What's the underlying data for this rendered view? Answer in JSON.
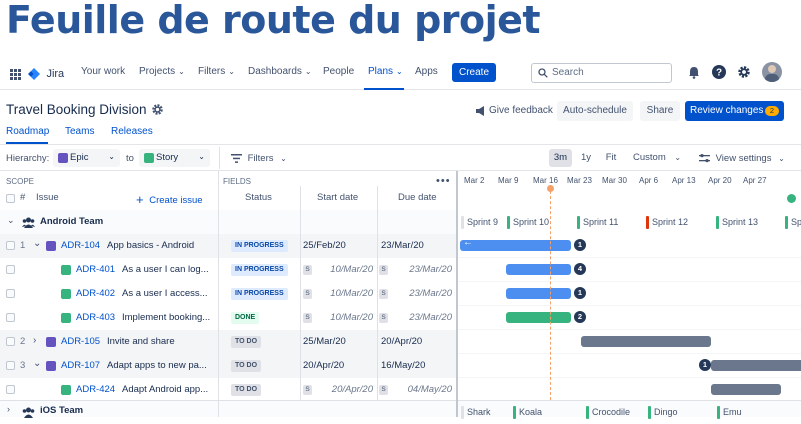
{
  "hero": {
    "title": "Feuille de route du projet"
  },
  "nav": {
    "logo": "Jira",
    "items": [
      {
        "label": "Your work",
        "dropdown": false
      },
      {
        "label": "Projects",
        "dropdown": true
      },
      {
        "label": "Filters",
        "dropdown": true
      },
      {
        "label": "Dashboards",
        "dropdown": true
      },
      {
        "label": "People",
        "dropdown": false
      },
      {
        "label": "Plans",
        "dropdown": true,
        "active": true
      },
      {
        "label": "Apps",
        "dropdown": false
      }
    ],
    "create_label": "Create",
    "search_placeholder": "Search"
  },
  "page": {
    "title": "Travel Booking Division",
    "give_feedback": "Give feedback",
    "auto_schedule": "Auto-schedule",
    "share": "Share",
    "review_changes": "Review changes",
    "review_count": "2",
    "tabs": [
      "Roadmap",
      "Teams",
      "Releases"
    ],
    "active_tab": "Roadmap"
  },
  "toolbar": {
    "hierarchy_label": "Hierarchy:",
    "hierarchy_from": "Epic",
    "to_label": "to",
    "hierarchy_to": "Story",
    "filters": "Filters",
    "zoom": [
      "3m",
      "1y",
      "Fit"
    ],
    "zoom_active": "3m",
    "custom": "Custom",
    "view_settings": "View settings"
  },
  "table": {
    "scope_label": "SCOPE",
    "fields_label": "FIELDS",
    "hash": "#",
    "issue_col": "Issue",
    "create_issue": "Create issue",
    "status_col": "Status",
    "start_col": "Start date",
    "due_col": "Due date"
  },
  "timeline": {
    "dates": [
      "Mar 2",
      "Mar 9",
      "Mar 16",
      "Mar 23",
      "Mar 30",
      "Apr 6",
      "Apr 13",
      "Apr 20",
      "Apr 27"
    ],
    "today": "Mar 16",
    "sprints": [
      "Sprint 9",
      "Sprint 10",
      "Sprint 11",
      "Sprint 12",
      "Sprint 13",
      "Sprint"
    ],
    "ios_sprints": [
      "Shark",
      "Koala",
      "Crocodile",
      "Dingo",
      "Emu"
    ]
  },
  "groups": [
    {
      "name": "Android Team"
    },
    {
      "name": "iOS Team"
    }
  ],
  "rows": [
    {
      "num": "1",
      "key": "ADR-104",
      "summary": "App basics - Android",
      "status": "IN PROGRESS",
      "start": "25/Feb/20",
      "due": "23/Mar/20",
      "type": "epic",
      "badge": "1",
      "inferred": false
    },
    {
      "num": "",
      "key": "ADR-401",
      "summary": "As a user I can log...",
      "status": "IN PROGRESS",
      "start": "10/Mar/20",
      "due": "23/Mar/20",
      "type": "story",
      "badge": "4",
      "inferred": true
    },
    {
      "num": "",
      "key": "ADR-402",
      "summary": "As a user I access...",
      "status": "IN PROGRESS",
      "start": "10/Mar/20",
      "due": "23/Mar/20",
      "type": "story",
      "badge": "1",
      "inferred": true
    },
    {
      "num": "",
      "key": "ADR-403",
      "summary": "Implement booking...",
      "status": "DONE",
      "start": "10/Mar/20",
      "due": "23/Mar/20",
      "type": "story",
      "badge": "2",
      "inferred": true
    },
    {
      "num": "2",
      "key": "ADR-105",
      "summary": "Invite and share",
      "status": "TO DO",
      "start": "25/Mar/20",
      "due": "20/Apr/20",
      "type": "epic",
      "badge": "",
      "inferred": false
    },
    {
      "num": "3",
      "key": "ADR-107",
      "summary": "Adapt apps to new pa...",
      "status": "TO DO",
      "start": "20/Apr/20",
      "due": "16/May/20",
      "type": "epic",
      "badge": "1",
      "inferred": false
    },
    {
      "num": "",
      "key": "ADR-424",
      "summary": "Adapt Android app...",
      "status": "TO DO",
      "start": "20/Apr/20",
      "due": "04/May/20",
      "type": "story",
      "badge": "",
      "inferred": true
    }
  ],
  "colors": {
    "accent": "#0052cc",
    "epic": "#6554c0",
    "story": "#36b37e",
    "bar_blue": "#4c8ff0",
    "bar_green": "#36b37e",
    "bar_gray": "#6b778c",
    "today_line": "#f4a26a"
  }
}
